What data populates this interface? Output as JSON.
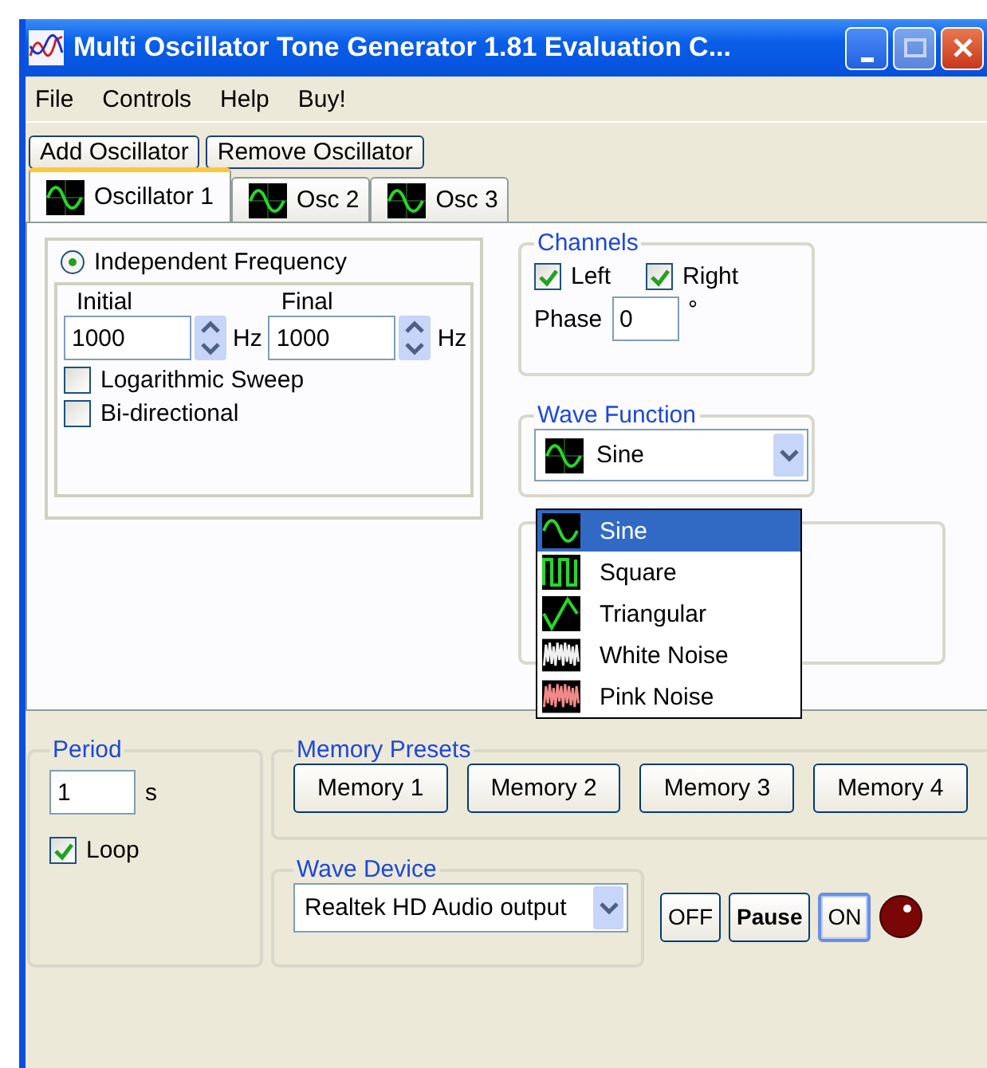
{
  "window": {
    "title": "Multi Oscillator Tone Generator 1.81 Evaluation C..."
  },
  "menu": [
    "File",
    "Controls",
    "Help",
    "Buy!"
  ],
  "toolbar_buttons": [
    "Add Oscillator",
    "Remove Oscillator"
  ],
  "tabs": [
    {
      "label": "Oscillator 1",
      "selected": true
    },
    {
      "label": "Osc 2",
      "selected": false
    },
    {
      "label": "Osc 3",
      "selected": false
    }
  ],
  "frequency": {
    "mode_label": "Independent Frequency",
    "mode_selected": true,
    "fields": [
      {
        "label": "Initial",
        "value": "1000",
        "unit": "Hz"
      },
      {
        "label": "Final",
        "value": "1000",
        "unit": "Hz"
      }
    ],
    "options": [
      {
        "label": "Logarithmic Sweep",
        "checked": false
      },
      {
        "label": "Bi-directional",
        "checked": false
      }
    ]
  },
  "channels": {
    "title": "Channels",
    "checks": [
      {
        "label": "Left",
        "checked": true
      },
      {
        "label": "Right",
        "checked": true
      }
    ],
    "phase_label": "Phase",
    "phase_value": "0",
    "phase_unit": "°"
  },
  "wave_function": {
    "title": "Wave Function",
    "value": "Sine",
    "expanded": true,
    "options": [
      {
        "label": "Sine",
        "kind": "sine",
        "selected": true
      },
      {
        "label": "Square",
        "kind": "square",
        "selected": false
      },
      {
        "label": "Triangular",
        "kind": "triangle",
        "selected": false
      },
      {
        "label": "White Noise",
        "kind": "white_noise",
        "selected": false
      },
      {
        "label": "Pink Noise",
        "kind": "pink_noise",
        "selected": false
      }
    ]
  },
  "period": {
    "title": "Period",
    "value": "1",
    "unit": "s",
    "loop": {
      "label": "Loop",
      "checked": true
    }
  },
  "memory_presets": {
    "title": "Memory Presets",
    "buttons": [
      "Memory 1",
      "Memory 2",
      "Memory 3",
      "Memory 4"
    ]
  },
  "wave_device": {
    "title": "Wave Device",
    "value": "Realtek HD Audio output"
  },
  "transport": [
    {
      "label": "OFF",
      "bold": false,
      "focused": false
    },
    {
      "label": "Pause",
      "bold": true,
      "focused": false
    },
    {
      "label": "ON",
      "bold": false,
      "focused": true
    }
  ],
  "indicator": {
    "lit": false
  }
}
